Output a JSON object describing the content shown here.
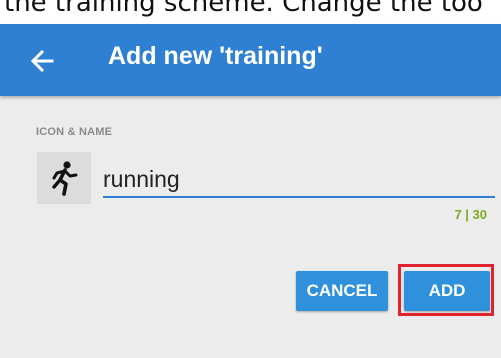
{
  "caption": {
    "text": "the training scheme. Change the too"
  },
  "app_bar": {
    "title": "Add new 'training'",
    "back_icon": "arrow-left-icon"
  },
  "form": {
    "section_label": "ICON & NAME",
    "activity_icon": "running-person-icon",
    "name_value": "running",
    "counter": "7 | 30"
  },
  "actions": {
    "cancel_label": "CANCEL",
    "add_label": "ADD"
  },
  "colors": {
    "app_bar": "#2f7fd2",
    "button": "#2f90dc",
    "counter": "#7cab20",
    "highlight": "#e0242f",
    "background": "#ececec"
  }
}
